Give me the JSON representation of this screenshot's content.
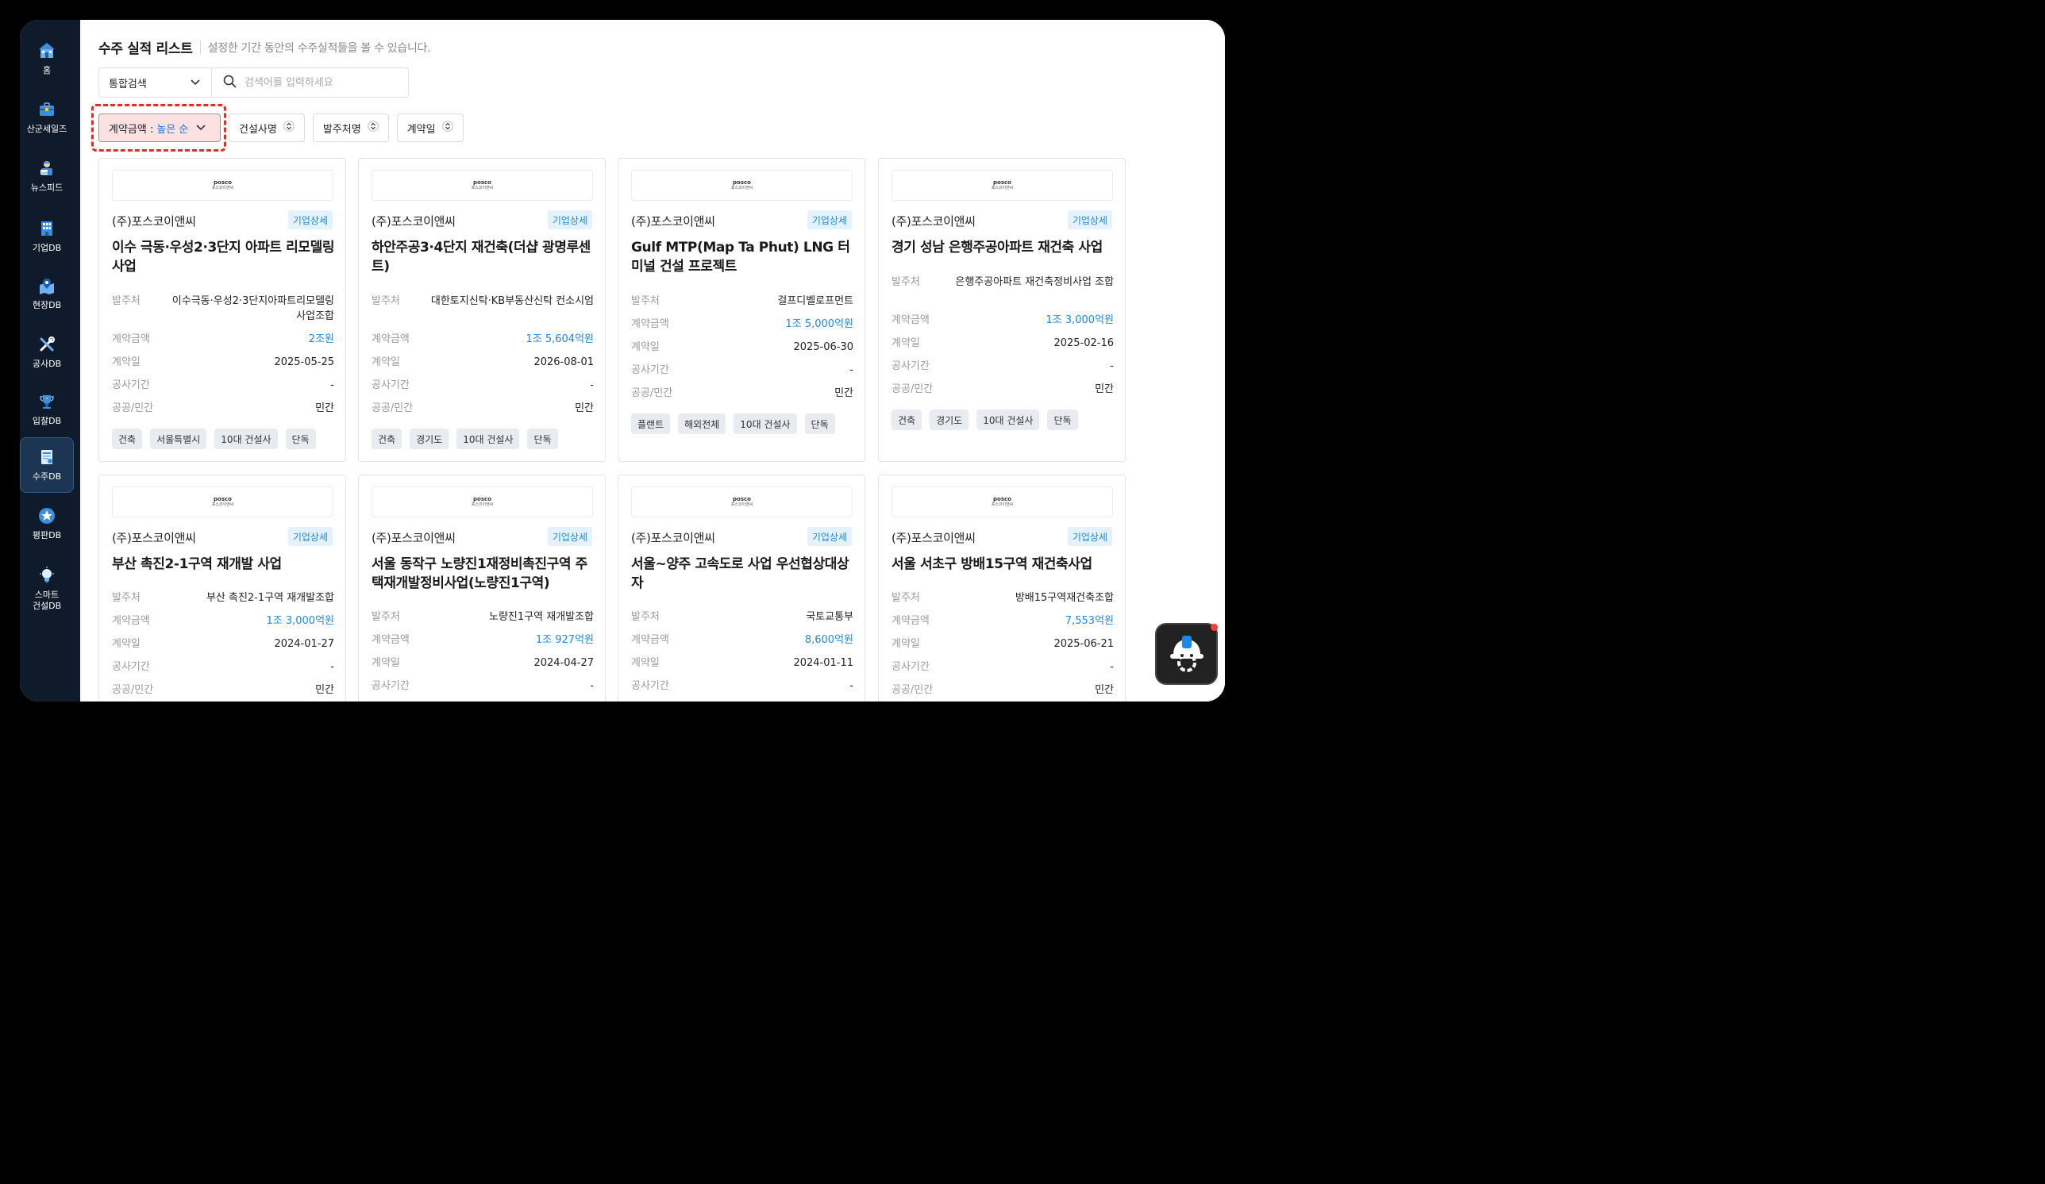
{
  "sidebar": {
    "items": [
      {
        "label": "홈",
        "icon": "home-icon"
      },
      {
        "label": "산군세일즈",
        "icon": "briefcase-icon"
      },
      {
        "label": "뉴스피드",
        "icon": "news-reader-icon"
      },
      {
        "label": "기업DB",
        "icon": "building-icon"
      },
      {
        "label": "현장DB",
        "icon": "map-pin-icon"
      },
      {
        "label": "공사DB",
        "icon": "tools-icon"
      },
      {
        "label": "입찰DB",
        "icon": "trophy-icon"
      },
      {
        "label": "수주DB",
        "icon": "contract-icon",
        "active": true
      },
      {
        "label": "평판DB",
        "icon": "star-icon"
      },
      {
        "label": "스마트\n건설DB",
        "icon": "lightbulb-icon"
      }
    ]
  },
  "header": {
    "title": "수주 실적 리스트",
    "subtitle": "설정한 기간 동안의 수주실적들을 볼 수 있습니다."
  },
  "search": {
    "select_value": "통합검색",
    "placeholder": "검색어를 입력하세요"
  },
  "filters": {
    "amount_label": "계약금액 :",
    "amount_value": "높은 순",
    "builder": "건설사명",
    "client": "발주처명",
    "contract_date": "계약일"
  },
  "labels": {
    "detail": "기업상세",
    "client": "발주처",
    "amount": "계약금액",
    "date": "계약일",
    "period": "공사기간",
    "sector": "공공/민간",
    "logo_main": "posco",
    "logo_sub": "포스코이앤씨"
  },
  "cards": [
    {
      "company": "(주)포스코이앤씨",
      "title": "이수 극동·우성2·3단지 아파트 리모델링 사업",
      "client": "이수극동·우성2·3단지아파트리모델링사업조합",
      "amount": "2조원",
      "date": "2025-05-25",
      "period": "-",
      "sector": "민간",
      "tags": [
        "건축",
        "서울특별시",
        "10대 건설사",
        "단독"
      ]
    },
    {
      "company": "(주)포스코이앤씨",
      "title": "하안주공3·4단지 재건축(더샵 광명루센트)",
      "client": "대한토지신탁·KB부동산신탁 컨소시엄",
      "amount": "1조 5,604억원",
      "date": "2026-08-01",
      "period": "-",
      "sector": "민간",
      "tags": [
        "건축",
        "경기도",
        "10대 건설사",
        "단독"
      ]
    },
    {
      "company": "(주)포스코이앤씨",
      "title": "Gulf MTP(Map Ta Phut) LNG 터미널 건설 프로젝트",
      "client": "걸프디벨로프먼트",
      "amount": "1조 5,000억원",
      "date": "2025-06-30",
      "period": "-",
      "sector": "민간",
      "tags": [
        "플랜트",
        "해외전체",
        "10대 건설사",
        "단독"
      ]
    },
    {
      "company": "(주)포스코이앤씨",
      "title": "경기 성남 은행주공아파트 재건축 사업",
      "client": "은행주공아파트 재건축정비사업 조합",
      "amount": "1조 3,000억원",
      "date": "2025-02-16",
      "period": "-",
      "sector": "민간",
      "tags": [
        "건축",
        "경기도",
        "10대 건설사",
        "단독"
      ]
    },
    {
      "company": "(주)포스코이앤씨",
      "title": "부산 촉진2-1구역 재개발 사업",
      "client": "부산 촉진2-1구역 재개발조합",
      "amount": "1조 3,000억원",
      "date": "2024-01-27",
      "period": "-",
      "sector": "민간",
      "tags": []
    },
    {
      "company": "(주)포스코이앤씨",
      "title": "서울 동작구 노량진1재정비촉진구역 주택재개발정비사업(노량진1구역)",
      "client": "노량진1구역 재개발조합",
      "amount": "1조 927억원",
      "date": "2024-04-27",
      "period": "-",
      "sector": "",
      "tags": []
    },
    {
      "company": "(주)포스코이앤씨",
      "title": "서울~양주 고속도로 사업 우선협상대상자",
      "client": "국토교통부",
      "amount": "8,600억원",
      "date": "2024-01-11",
      "period": "-",
      "sector": "",
      "tags": []
    },
    {
      "company": "(주)포스코이앤씨",
      "title": "서울 서초구 방배15구역 재건축사업",
      "client": "방배15구역재건축조합",
      "amount": "7,553억원",
      "date": "2025-06-21",
      "period": "-",
      "sector": "민간",
      "tags": []
    }
  ],
  "chatbot": {
    "icon": "helmet-bot-icon"
  }
}
